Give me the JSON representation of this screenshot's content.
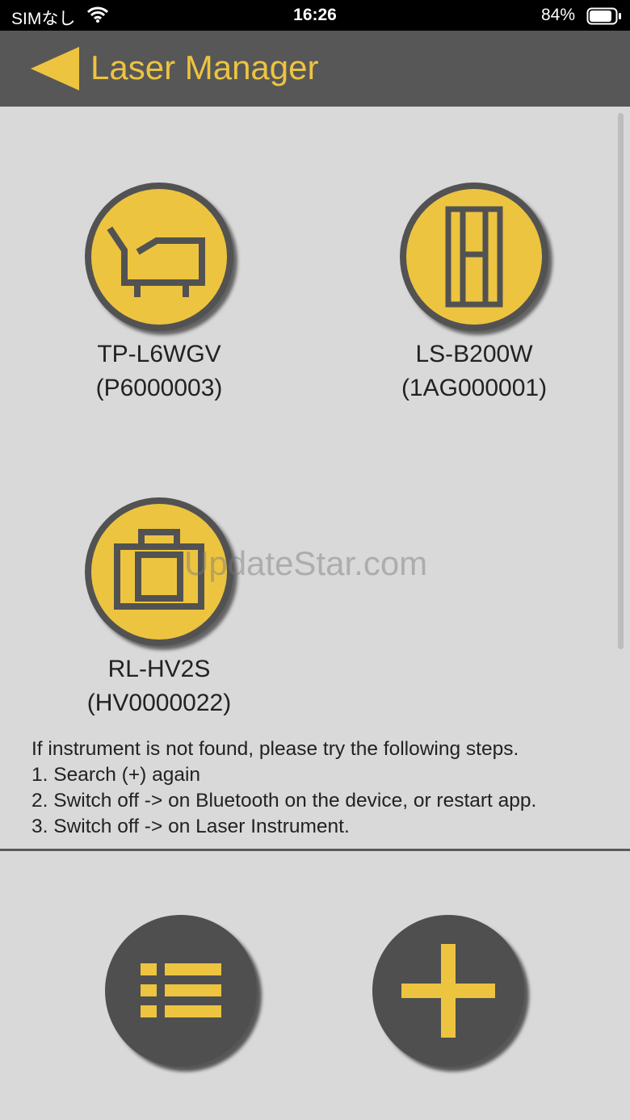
{
  "status": {
    "carrier": "SIMなし",
    "time": "16:26",
    "battery": "84%"
  },
  "header": {
    "title": "Laser Manager",
    "accent_color": "#edc440",
    "background": "#575757"
  },
  "devices": [
    {
      "model": "TP-L6WGV",
      "serial": "(P6000003)",
      "icon": "pipe-laser-icon"
    },
    {
      "model": "LS-B200W",
      "serial": "(1AG000001)",
      "icon": "line-laser-icon"
    },
    {
      "model": "RL-HV2S",
      "serial": "(HV0000022)",
      "icon": "rotating-laser-icon"
    }
  ],
  "watermark": "UpdateStar.com",
  "instructions": [
    "If instrument is not found, please try the following steps.",
    "1. Search (+) again",
    "2. Switch off -> on Bluetooth on the device, or restart app.",
    "3. Switch off -> on Laser Instrument."
  ],
  "toolbar": {
    "list_icon": "list-icon",
    "add_icon": "plus-icon"
  }
}
